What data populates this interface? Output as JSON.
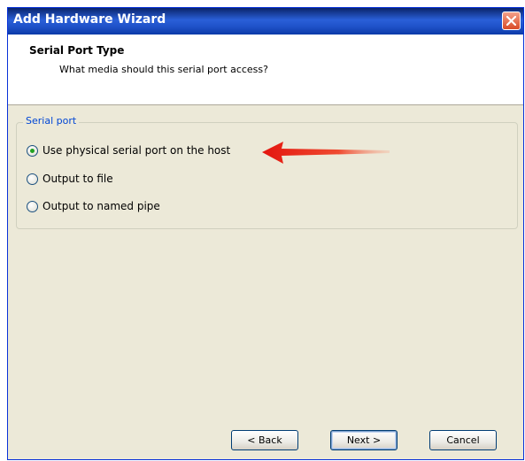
{
  "window": {
    "title": "Add Hardware Wizard"
  },
  "header": {
    "title": "Serial Port Type",
    "subtitle": "What media should this serial port access?"
  },
  "serial_port": {
    "group_label": "Serial port",
    "options": [
      {
        "label": "Use physical serial port on the host",
        "selected": true
      },
      {
        "label": "Output to file",
        "selected": false
      },
      {
        "label": "Output to named pipe",
        "selected": false
      }
    ]
  },
  "buttons": {
    "back": "< Back",
    "next": "Next >",
    "cancel": "Cancel"
  },
  "colors": {
    "title_bar": "#2a5fd8",
    "close_button": "#d94b27",
    "group_label": "#0046d5",
    "radio_selected": "#21a121",
    "annotation_arrow": "#e3160f"
  },
  "icons": {
    "close": "close-icon",
    "annotation": "red-arrow-icon"
  }
}
